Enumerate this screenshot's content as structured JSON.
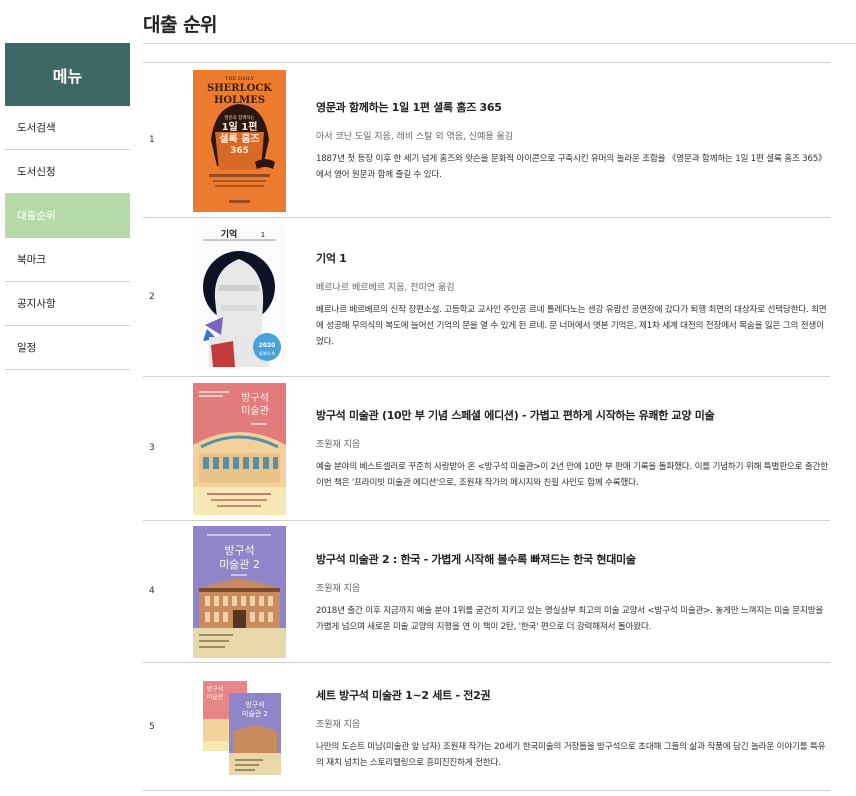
{
  "page_title": "대출 순위",
  "sidebar": {
    "header": "메뉴",
    "items": [
      {
        "label": "도서검색"
      },
      {
        "label": "도서신청"
      },
      {
        "label": "대출순위"
      },
      {
        "label": "북마크"
      },
      {
        "label": "공지사항"
      },
      {
        "label": "일정"
      }
    ]
  },
  "colors": {
    "sidebar_header": "#3e6866",
    "active_menu": "#b5dba8"
  },
  "books": [
    {
      "rank": "1",
      "title": "영문과 함께하는 1일 1편 셜록 홈즈 365",
      "author": "아서 코난 도일 지음, 레비 스탈 외 엮음, 신예용 옮김",
      "description": "1887년 첫 등장 이후 한 세기 넘게 홈즈와 왓슨을 문화적 아이콘으로 구축시킨 유머의 놀라운 조합을 《영문과 함께하는 1일 1편 셜록 홈즈 365》에서 영어 원문과 함께 즐길 수 있다.",
      "cover": {
        "en_title_1": "THE DAILY",
        "en_title_2": "SHERLOCK",
        "en_title_3": "HOLMES",
        "kr_title_1": "영문과 함께하는",
        "kr_title_2": "1일 1편",
        "kr_title_3": "셜록 홈즈",
        "kr_title_4": "365"
      }
    },
    {
      "rank": "2",
      "title": "기억 1",
      "author": "베르나르 베르베르 지음, 전미연 옮김",
      "description": "베르나르 베르베르의 신작 장편소설. 고등학교 교사인 주인공 르네 톨레다노는 센강 유람선 공연장에 갔다가 퇴행 최면의 대상자로 선택당한다. 최면에 성공해 무의식의 복도에 늘어선 기억의 문을 열 수 있게 된 르네. 문 너머에서 엿본 기억은, 제1차 세계 대전의 전장에서 목숨을 잃은 그의 전생이었다.",
      "cover": {
        "kr_title": "기억",
        "volume": "1",
        "badge_year": "2020",
        "badge_text": "올해의 책"
      }
    },
    {
      "rank": "3",
      "title": "방구석 미술관 (10만 부 기념 스페셜 에디션) - 가볍고 편하게 시작하는 유쾌한 교양 미술",
      "author": "조원재 지음",
      "description": "예술 분야의 베스트셀러로 꾸준히 사랑받아 온 <방구석 미술관>이 2년 만에 10만 부 판매 기록을 돌파했다. 이를 기념하기 위해 특별판으로 출간한 이번 책은 '프라이빗 미술관 에디션'으로, 조원재 작가의 메시지와 친필 사인도 함께 수록했다.",
      "cover": {
        "kr_title_1": "방구석",
        "kr_title_2": "미술관"
      }
    },
    {
      "rank": "4",
      "title": "방구석 미술관 2 : 한국 - 가볍게 시작해 볼수록 빠져드는 한국 현대미술",
      "author": "조원재 지음",
      "description": "2018년 출간 이후 지금까지 예술 분야 1위를 굳건히 지키고 있는 명실상부 최고의 미술 교양서 <방구석 미술관>. 놓게만 느껴지는 미술 문지방을 가볍게 넘으며 새로운 미술 교양의 지평을 연 이 책이 2탄, '한국' 편으로 더 강력해져서 돌아왔다.",
      "cover": {
        "kr_title_1": "방구석",
        "kr_title_2": "미술관 2"
      }
    },
    {
      "rank": "5",
      "title": "세트 방구석 미술관 1~2 세트 - 전2권",
      "author": "조원재 지음",
      "description": "나만의 도슨트 미남(미술관 앞 남자) 조원재 작가는 20세기 한국미술의 거장들을 방구석으로 초대해 그들의 삶과 작품에 담긴 놀라운 이야기를 특유의 재치 넘치는 스토리텔링으로 흥미진진하게 전한다.",
      "cover": {
        "kr_title_1": "방구석",
        "kr_title_2": "미술관",
        "kr_title_3": "방구석",
        "kr_title_4": "미술관 2"
      }
    }
  ]
}
